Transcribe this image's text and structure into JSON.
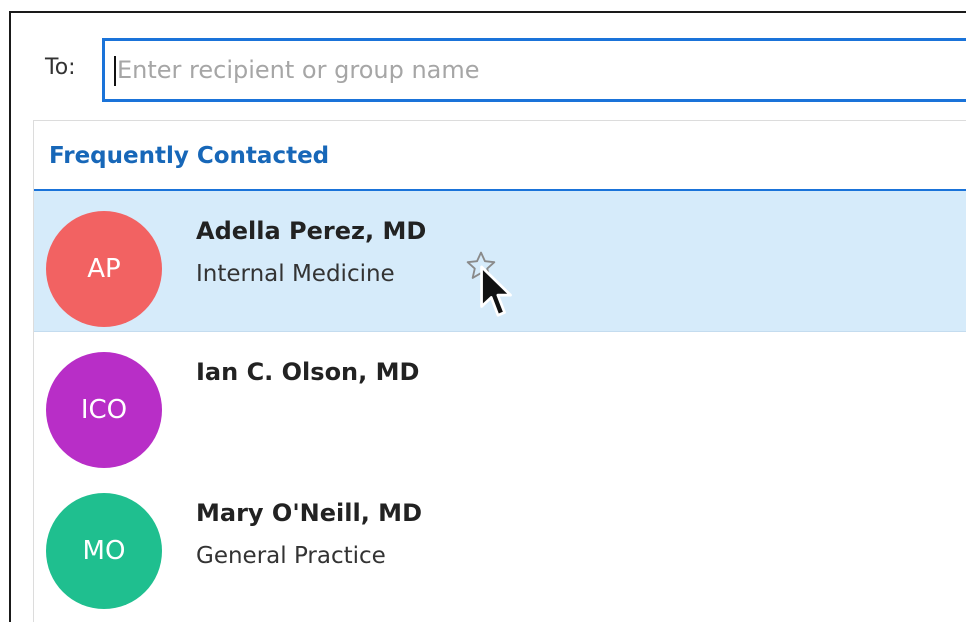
{
  "compose": {
    "to_label": "To:",
    "recipient_placeholder": "Enter recipient or group name",
    "recipient_value": ""
  },
  "suggestions": {
    "section_title": "Frequently Contacted",
    "contacts": [
      {
        "initials": "AP",
        "name": "Adella Perez, MD",
        "specialty": "Internal Medicine",
        "avatar_color": "#f26262",
        "selected": true,
        "favorite_icon": "star-outline-icon"
      },
      {
        "initials": "ICO",
        "name": "Ian C. Olson, MD",
        "specialty": "",
        "avatar_color": "#b82ec7",
        "selected": false
      },
      {
        "initials": "MO",
        "name": "Mary O'Neill, MD",
        "specialty": "General Practice",
        "avatar_color": "#1fbf8f",
        "selected": false
      }
    ]
  },
  "colors": {
    "accent": "#1a73d9",
    "section_title": "#1767b8",
    "selected_row": "#d6ebfa"
  },
  "pointer": {
    "icon": "mouse-pointer-icon"
  }
}
